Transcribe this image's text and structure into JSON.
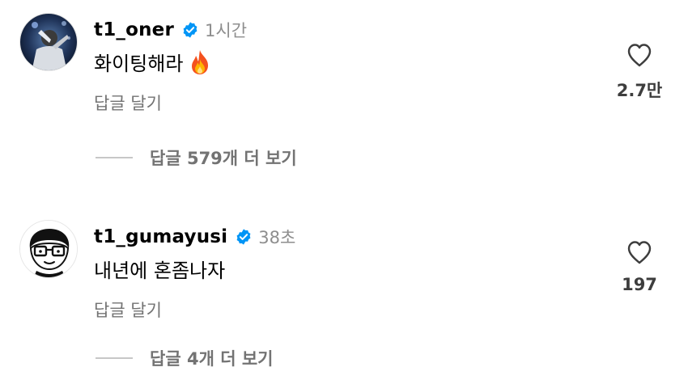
{
  "comments": [
    {
      "username": "t1_oner",
      "time": "1시간",
      "text": "화이팅해라",
      "reply_label": "답글 달기",
      "like_count": "2.7만",
      "view_replies": "답글 579개 더 보기"
    },
    {
      "username": "t1_gumayusi",
      "time": "38초",
      "text": "내년에 혼좀나자",
      "reply_label": "답글 달기",
      "like_count": "197",
      "view_replies": "답글 4개 더 보기"
    }
  ],
  "icons": {
    "verified": "verified-badge-icon",
    "like": "heart-icon",
    "emoji": "fire-emoji-icon"
  },
  "colors": {
    "verified": "#0095f6",
    "secondary_text": "#737373",
    "time_text": "#8e8e8e"
  }
}
